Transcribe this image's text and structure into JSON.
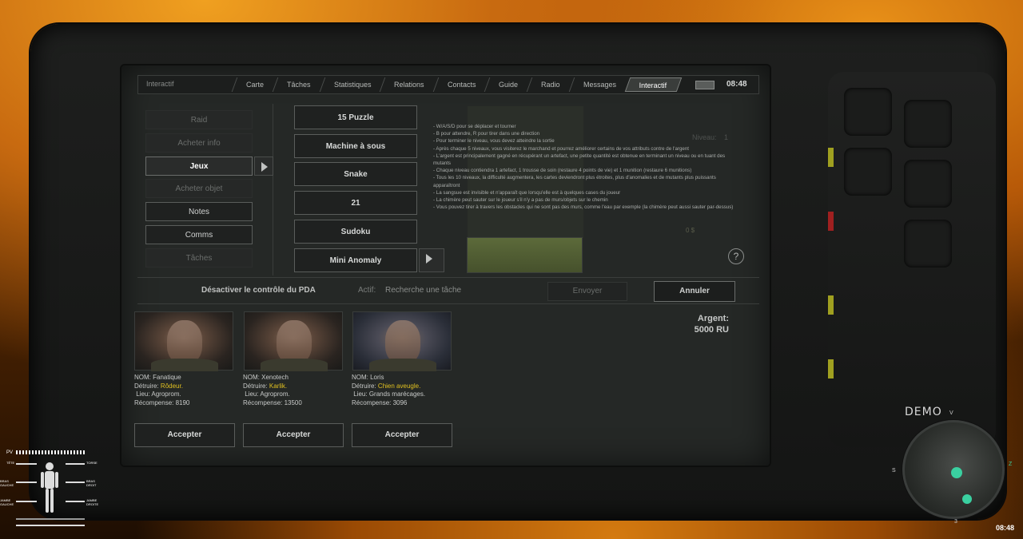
{
  "topbar": {
    "section": "Interactif",
    "tabs": [
      "Carte",
      "Tâches",
      "Statistiques",
      "Relations",
      "Contacts",
      "Guide",
      "Radio",
      "Messages",
      "Interactif"
    ],
    "time": "08:48"
  },
  "menu": {
    "items": [
      "Raid",
      "Acheter info",
      "Jeux",
      "Acheter objet",
      "Notes",
      "Comms",
      "Tâches"
    ]
  },
  "games": {
    "items": [
      "15 Puzzle",
      "Machine à sous",
      "Snake",
      "21",
      "Sudoku",
      "Mini Anomaly"
    ]
  },
  "instructions": {
    "lines": [
      "- W/A/S/D pour se déplacer et tourner",
      "- B pour attendre, R pour tirer dans une direction",
      "- Pour terminer le niveau, vous devez atteindre la sortie",
      "- Après chaque 5 niveaux, vous visiterez le marchand et pourrez améliorer certains de vos attributs contre de l'argent",
      "- L'argent est principalement gagné en récupérant un artefact, une petite quantité est obtenue en terminant un niveau ou en tuant des mutants",
      "- Chaque niveau contiendra 1 artefact, 1 trousse de soin (restaure 4 points de vie) et 1 munition (restaure 6 munitions)",
      "- Tous les 10 niveaux, la difficulté augmentera, les cartes deviendront plus étroites, plus d'anomalies et de mutants plus puissants apparaîtront",
      "- La sangsue est invisible et n'apparaît que lorsqu'elle est à quelques cases du joueur",
      "- La chimère peut sauter sur le joueur s'il n'y a pas de murs/objets sur le chemin",
      "- Vous pouvez tirer à travers les obstacles qui ne sont pas des murs, comme l'eau par exemple (la chimère peut aussi sauter par-dessus)"
    ],
    "level_label": "Niveau:",
    "level_value": "1",
    "score": "0 $"
  },
  "actions": {
    "pda_toggle": "Désactiver le contrôle du PDA",
    "actif_label": "Actif:",
    "actif_value": "Recherche une tâche",
    "send": "Envoyer",
    "cancel": "Annuler"
  },
  "targets": [
    {
      "nom": "NOM: Fanatique",
      "detruire_label": "Détruire:",
      "detruire": "Rôdeur.",
      "lieu_label": "Lieu:",
      "lieu": "Agroprom.",
      "recompense": "Récompense: 8190",
      "accept": "Accepter"
    },
    {
      "nom": "NOM: Xenotech",
      "detruire_label": "Détruire:",
      "detruire": "Karlik.",
      "lieu_label": "Lieu:",
      "lieu": "Agroprom.",
      "recompense": "Récompense: 13500",
      "accept": "Accepter"
    },
    {
      "nom": "NOM: Loris",
      "detruire_label": "Détruire:",
      "detruire": "Chien aveugle.",
      "lieu_label": "Lieu:",
      "lieu": "Grands marécages.",
      "recompense": "Récompense: 3096",
      "accept": "Accepter"
    }
  ],
  "money": {
    "label": "Argent:",
    "value": "5000 RU"
  },
  "hud": {
    "pv": "PV",
    "labels": [
      "TÊTE",
      "TORSE",
      "BRAS GAUCHE",
      "BRAS DROIT",
      "JAMBE GAUCHE",
      "JAMBE DROITE"
    ],
    "demo": "DEMO",
    "compass": {
      "s": "S",
      "z": "Z",
      "v": "V",
      "three": "3"
    },
    "time": "08:48"
  },
  "colors": {
    "highlight": "#e0c020",
    "accent_green": "#3ad0a0"
  }
}
